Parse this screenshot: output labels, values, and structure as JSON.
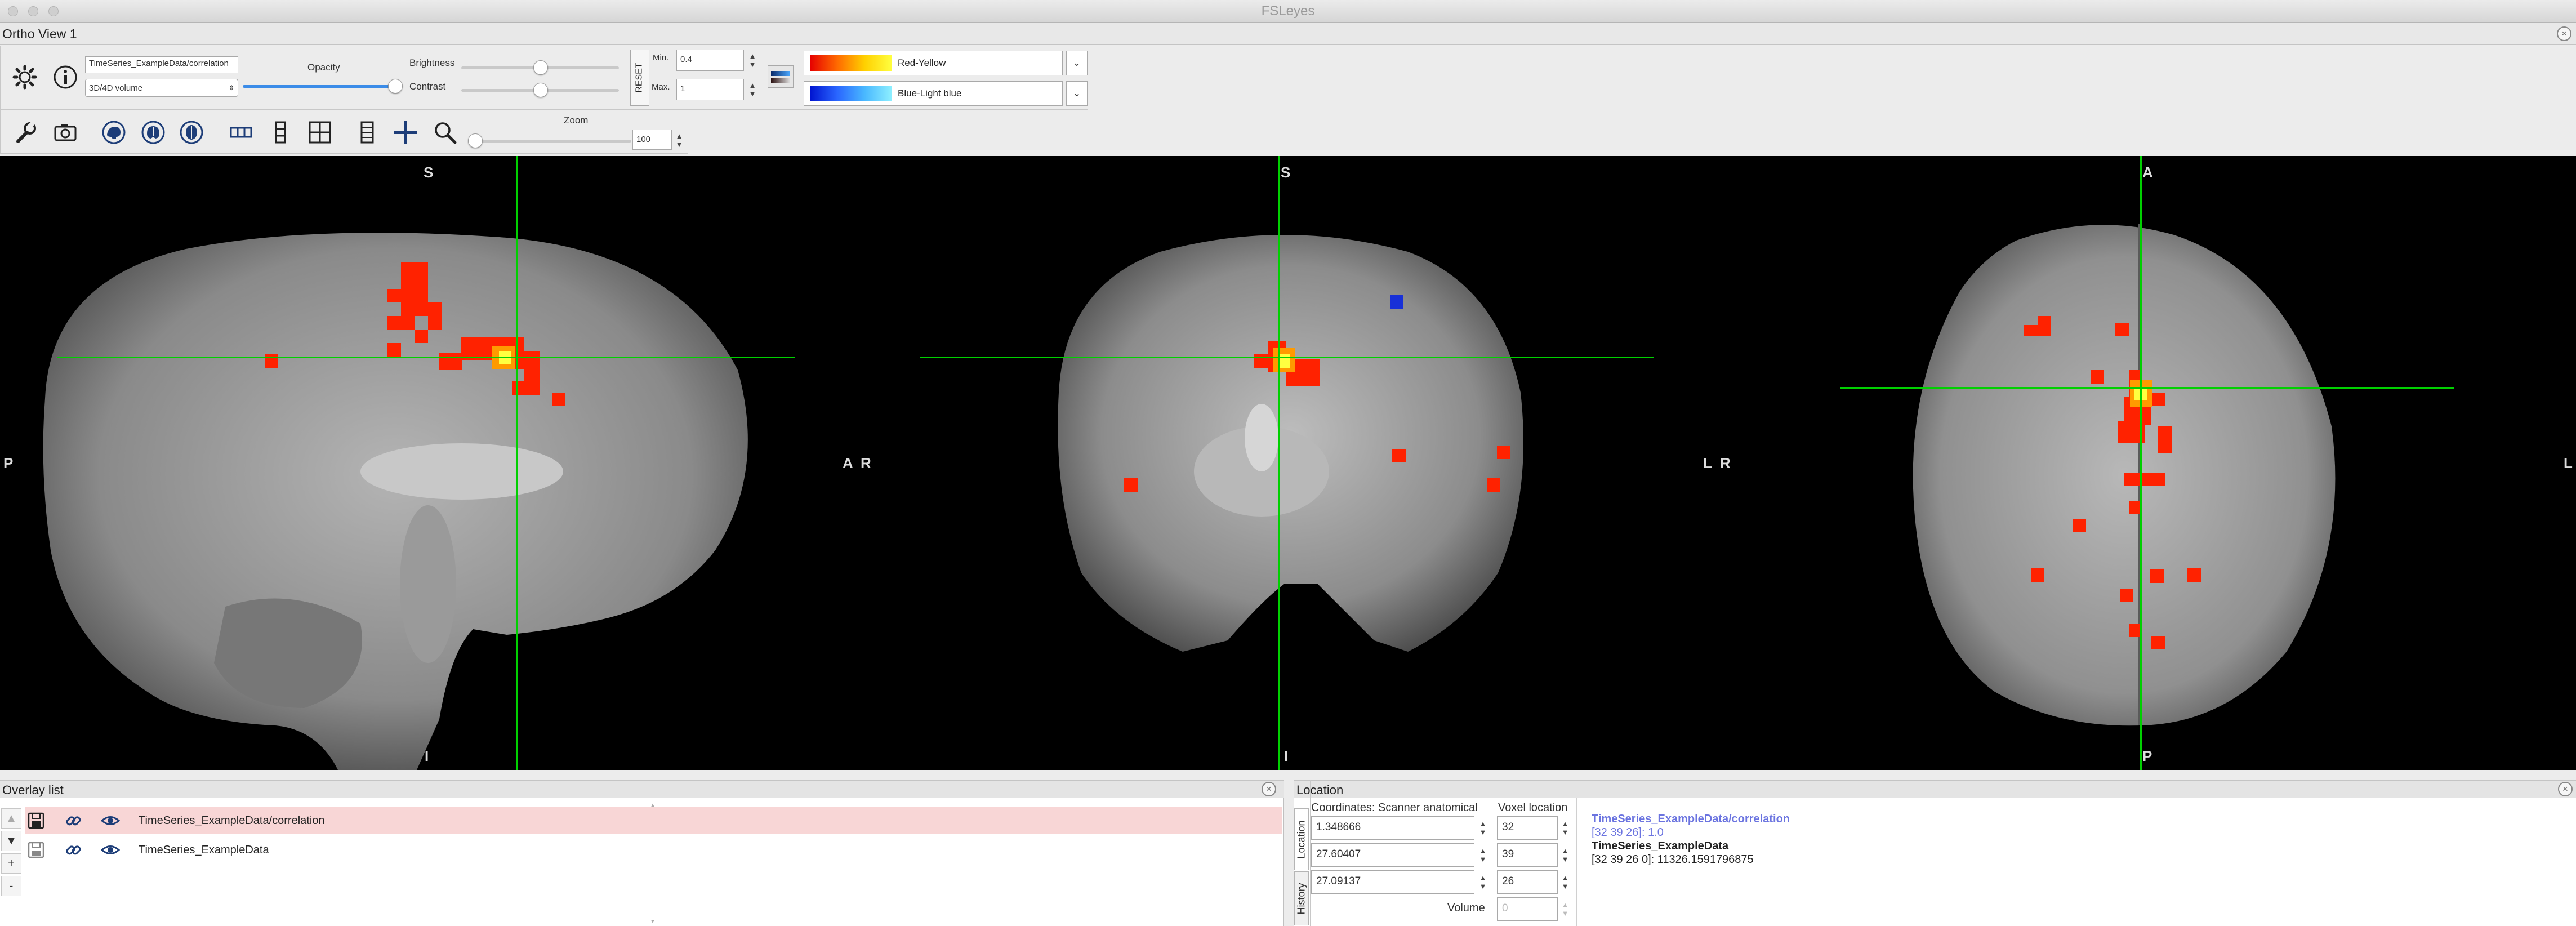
{
  "window": {
    "title": "FSLeyes",
    "view_title": "Ortho View 1"
  },
  "overlay_toolbar": {
    "overlay_name": "TimeSeries_ExampleData/correlation",
    "overlay_type": "3D/4D volume",
    "opacity_label": "Opacity",
    "opacity_value": 1.0,
    "brightness_label": "Brightness",
    "brightness_value": 0.5,
    "contrast_label": "Contrast",
    "contrast_value": 0.5,
    "reset_label": "RESET",
    "min_label": "Min.",
    "min_value": "0.4",
    "max_label": "Max.",
    "max_value": "1",
    "cmap_label": "Red-Yellow",
    "neg_cmap_label": "Blue-Light blue"
  },
  "ortho_toolbar": {
    "zoom_label": "Zoom",
    "zoom_value": "100"
  },
  "views": {
    "sagittal": {
      "top": "S",
      "bottom": "I",
      "left": "P",
      "right": "A"
    },
    "coronal": {
      "top": "S",
      "bottom": "I",
      "left": "R",
      "right": "L"
    },
    "axial": {
      "top": "A",
      "bottom": "P",
      "left": "R",
      "right": "L"
    }
  },
  "overlay_list": {
    "title": "Overlay list",
    "items": [
      {
        "name": "TimeSeries_ExampleData/correlation",
        "selected": true
      },
      {
        "name": "TimeSeries_ExampleData",
        "selected": false
      }
    ],
    "side_buttons": [
      "▲",
      "▼",
      "+",
      "-"
    ]
  },
  "location": {
    "title": "Location",
    "coords_header": "Coordinates: Scanner anatomical",
    "voxel_header": "Voxel location",
    "world_coords": [
      "1.348666",
      "27.60407",
      "27.09137"
    ],
    "voxel_coords": [
      "32",
      "39",
      "26"
    ],
    "volume_label": "Volume",
    "volume_value": "0",
    "tabs": [
      "Location",
      "History"
    ],
    "info": {
      "overlay1_name": "TimeSeries_ExampleData/correlation",
      "overlay1_value": "[32 39 26]: 1.0",
      "overlay2_name": "TimeSeries_ExampleData",
      "overlay2_value": "[32 39 26 0]: 11326.1591796875"
    }
  },
  "colors": {
    "cursor": "#00d000",
    "selected_row": "#f8d6d6",
    "info_highlight": "#6b74e0"
  }
}
